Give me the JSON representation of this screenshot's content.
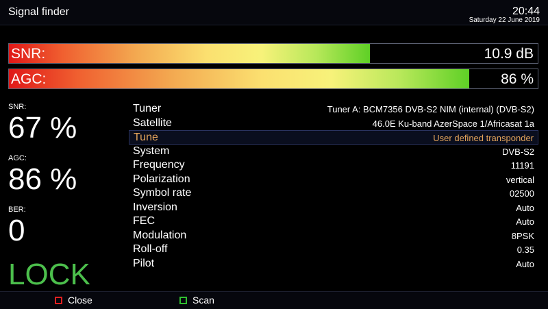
{
  "header": {
    "title": "Signal finder",
    "time": "20:44",
    "date": "Saturday 22 June 2019"
  },
  "bars": {
    "snr": {
      "label": "SNR:",
      "value": "10.9 dB",
      "fill": 0.683
    },
    "agc": {
      "label": "AGC:",
      "value": "86 %",
      "fill": 0.87
    }
  },
  "stats": {
    "snr": {
      "label": "SNR:",
      "value": "67 %"
    },
    "agc": {
      "label": "AGC:",
      "value": "86 %"
    },
    "ber": {
      "label": "BER:",
      "value": "0"
    },
    "lock": "LOCK"
  },
  "info": [
    {
      "key": "Tuner",
      "value": "Tuner A: BCM7356 DVB-S2 NIM (internal) (DVB-S2)"
    },
    {
      "key": "Satellite",
      "value": "46.0E Ku-band AzerSpace 1/Africasat 1a"
    },
    {
      "key": "Tune",
      "value": "User defined transponder",
      "selected": true
    },
    {
      "key": "System",
      "value": "DVB-S2"
    },
    {
      "key": "Frequency",
      "value": "11191"
    },
    {
      "key": "Polarization",
      "value": "vertical"
    },
    {
      "key": "Symbol rate",
      "value": "02500"
    },
    {
      "key": "Inversion",
      "value": "Auto"
    },
    {
      "key": "FEC",
      "value": "Auto"
    },
    {
      "key": "Modulation",
      "value": "8PSK"
    },
    {
      "key": "Roll-off",
      "value": "0.35"
    },
    {
      "key": "Pilot",
      "value": "Auto"
    }
  ],
  "buttons": {
    "close": {
      "label": "Close",
      "color": "#e02020",
      "icon": "red-key-icon"
    },
    "scan": {
      "label": "Scan",
      "color": "#30c030",
      "icon": "green-key-icon"
    }
  }
}
